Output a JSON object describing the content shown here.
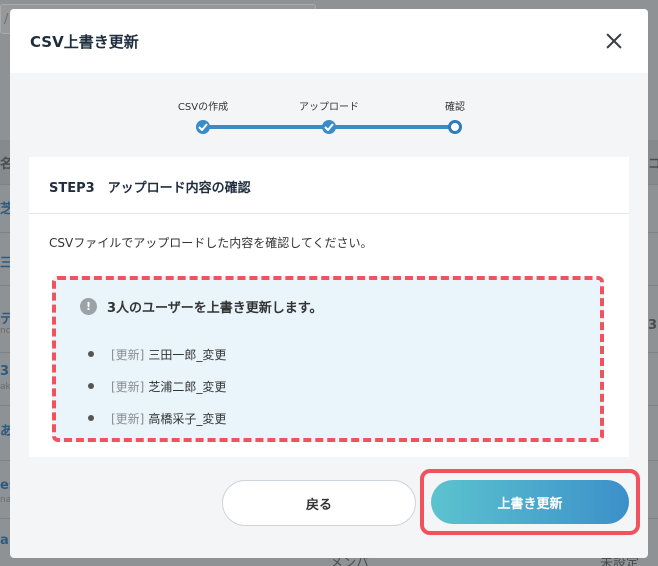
{
  "modal": {
    "title": "CSV上書き更新"
  },
  "stepper": {
    "steps": [
      {
        "label": "CSVの作成",
        "state": "done"
      },
      {
        "label": "アップロード",
        "state": "done"
      },
      {
        "label": "確認",
        "state": "current"
      }
    ]
  },
  "panel": {
    "heading": "STEP3　アップロード内容の確認",
    "description": "CSVファイルでアップロードした内容を確認してください。",
    "notice": {
      "title": "3人のユーザーを上書き更新します。",
      "items": [
        {
          "tag": "[更新]",
          "name": "三田一郎_変更"
        },
        {
          "tag": "[更新]",
          "name": "芝浦二郎_変更"
        },
        {
          "tag": "[更新]",
          "name": "高橋采子_変更"
        }
      ]
    }
  },
  "footer": {
    "back_label": "戻る",
    "submit_label": "上書き更新"
  },
  "background": {
    "search_prefix": "/",
    "header_fragment": "名",
    "right_fragments": [
      "コ",
      "3"
    ],
    "row_fragments": [
      "芝",
      "三",
      "テ",
      "3",
      "あ",
      "es",
      "a"
    ],
    "sub_fragments": [
      "nc",
      "ak",
      "na"
    ],
    "bottom_fragments": [
      "メンバ",
      "未設定"
    ]
  },
  "colors": {
    "accent": "#3a8cc9",
    "highlight": "#f0535e",
    "notice_bg": "#eaf4fb"
  }
}
